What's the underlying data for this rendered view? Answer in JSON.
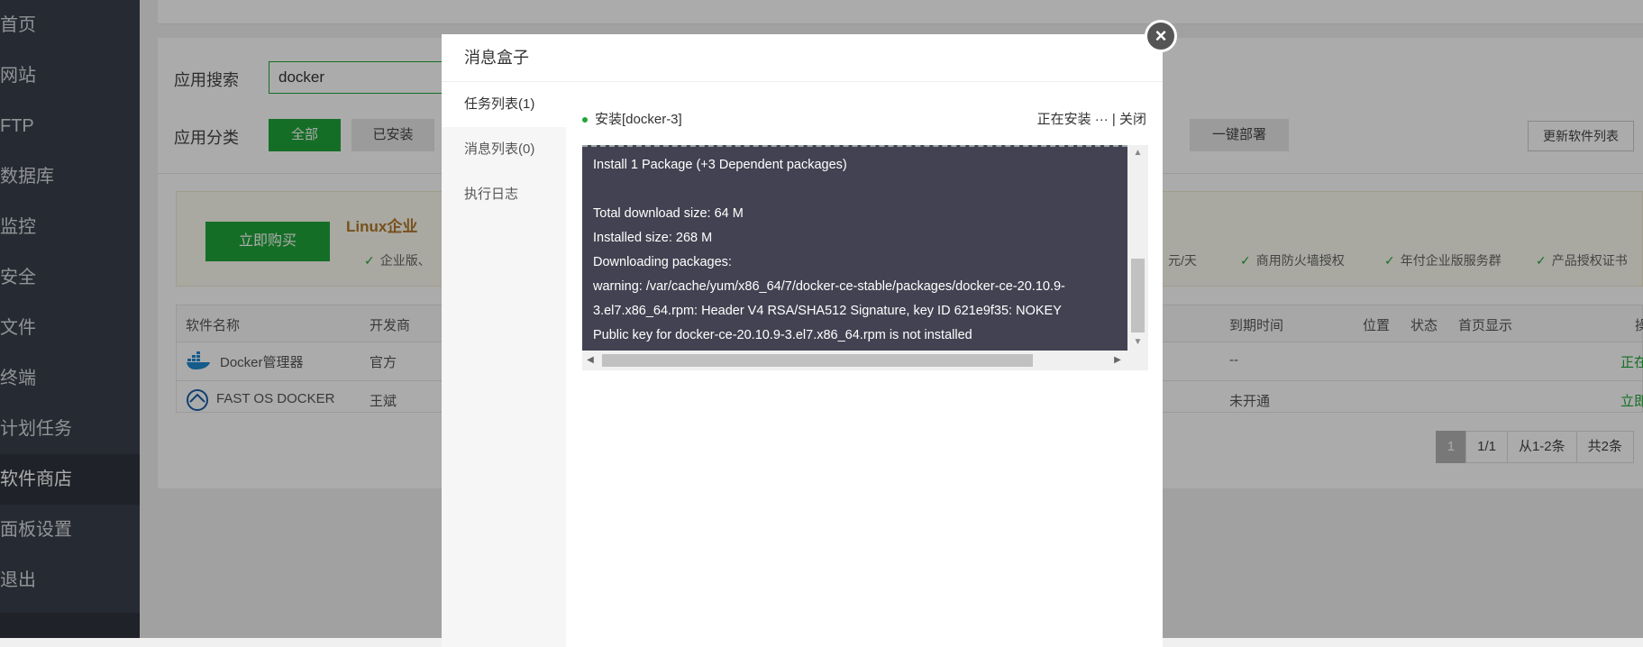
{
  "sidebar": {
    "items": [
      {
        "label": "首页"
      },
      {
        "label": "网站"
      },
      {
        "label": "FTP"
      },
      {
        "label": "数据库"
      },
      {
        "label": "监控"
      },
      {
        "label": "安全"
      },
      {
        "label": "文件"
      },
      {
        "label": "终端"
      },
      {
        "label": "计划任务"
      },
      {
        "label": "软件商店",
        "active": true
      },
      {
        "label": "面板设置"
      },
      {
        "label": "退出"
      }
    ]
  },
  "search": {
    "label": "应用搜索",
    "value": "docker"
  },
  "category": {
    "label": "应用分类",
    "buttons": [
      "全部",
      "已安装",
      "一键部署"
    ],
    "refresh_label": "更新软件列表"
  },
  "promo": {
    "buy_label": "立即购买",
    "title": "Linux企业",
    "features": [
      "企业版、",
      "元/天",
      "商用防火墙授权",
      "年付企业版服务群",
      "产品授权证书"
    ]
  },
  "table": {
    "headers": [
      "软件名称",
      "开发商",
      "到期时间",
      "位置",
      "状态",
      "首页显示",
      "操作"
    ],
    "rows": [
      {
        "name": "Docker管理器",
        "vendor": "官方",
        "expire": "--",
        "action": "正在安装"
      },
      {
        "name": "FAST OS DOCKER",
        "vendor": "王斌",
        "expire": "未开通",
        "action": "立即购买"
      }
    ]
  },
  "pager": {
    "current": "1",
    "pages": "1/1",
    "range": "从1-2条",
    "total": "共2条"
  },
  "modal": {
    "title": "消息盒子",
    "tabs": [
      "任务列表(1)",
      "消息列表(0)",
      "执行日志"
    ],
    "task": {
      "name": "安装[docker-3]",
      "status": "正在安装 ···",
      "close": "| 关闭"
    },
    "console_lines": [
      "Install 1 Package (+3 Dependent packages)",
      "",
      "Total download size: 64 M",
      "Installed size: 268 M",
      "Downloading packages:",
      "warning: /var/cache/yum/x86_64/7/docker-ce-stable/packages/docker-ce-20.10.9-",
      "3.el7.x86_64.rpm: Header V4 RSA/SHA512 Signature, key ID 621e9f35: NOKEY",
      "Public key for docker-ce-20.10.9-3.el7.x86_64.rpm is not installed"
    ],
    "close_icon": "×"
  },
  "colors": {
    "accent": "#20a53a",
    "sidebar": "#3a3f4b",
    "console": "#434252"
  }
}
